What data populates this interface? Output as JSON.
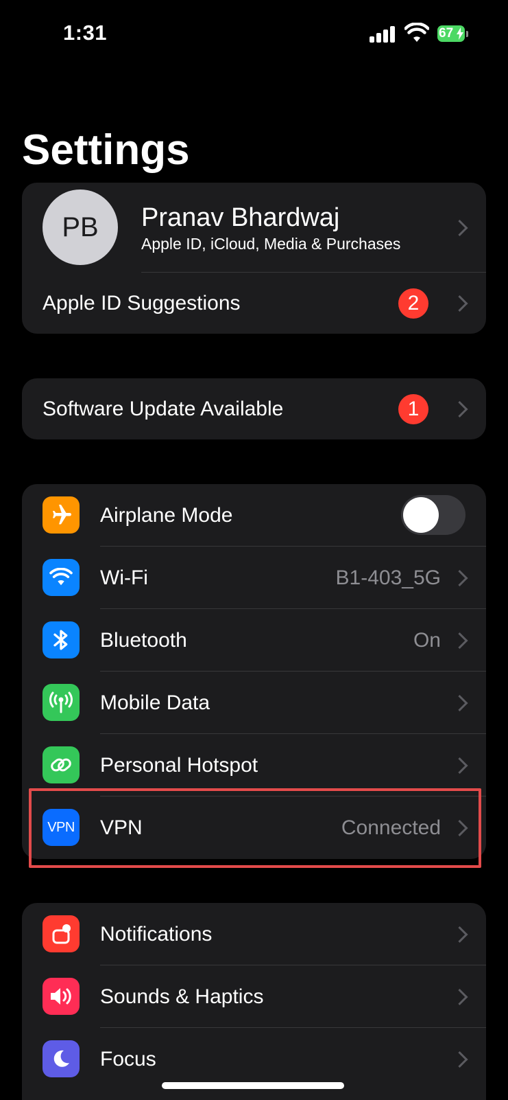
{
  "status_bar": {
    "time": "1:31",
    "battery": "67"
  },
  "title": "Settings",
  "profile": {
    "initials": "PB",
    "name": "Pranav Bhardwaj",
    "subtitle": "Apple ID, iCloud, Media & Purchases"
  },
  "apple_id_suggestions": {
    "label": "Apple ID Suggestions",
    "badge": "2"
  },
  "software_update": {
    "label": "Software Update Available",
    "badge": "1"
  },
  "connectivity": {
    "airplane": {
      "label": "Airplane Mode",
      "on": false,
      "icon": "airplane-icon",
      "color": "#ff9500"
    },
    "wifi": {
      "label": "Wi-Fi",
      "value": "B1-403_5G",
      "icon": "wifi-icon",
      "color": "#0a84ff"
    },
    "bluetooth": {
      "label": "Bluetooth",
      "value": "On",
      "icon": "bluetooth-icon",
      "color": "#0a84ff"
    },
    "mobile_data": {
      "label": "Mobile Data",
      "icon": "antenna-icon",
      "color": "#34c759"
    },
    "hotspot": {
      "label": "Personal Hotspot",
      "icon": "link-icon",
      "color": "#34c759"
    },
    "vpn": {
      "label": "VPN",
      "value": "Connected",
      "icon_text": "VPN",
      "icon": "vpn-icon",
      "color": "#0a6cff"
    }
  },
  "general": {
    "notifications": {
      "label": "Notifications",
      "icon": "bell-icon",
      "color": "#ff3b30"
    },
    "sounds": {
      "label": "Sounds & Haptics",
      "icon": "speaker-icon",
      "color": "#ff2d55"
    },
    "focus": {
      "label": "Focus",
      "icon": "moon-icon",
      "color": "#5e5ce6"
    }
  },
  "highlight_color": "#e34b4b"
}
